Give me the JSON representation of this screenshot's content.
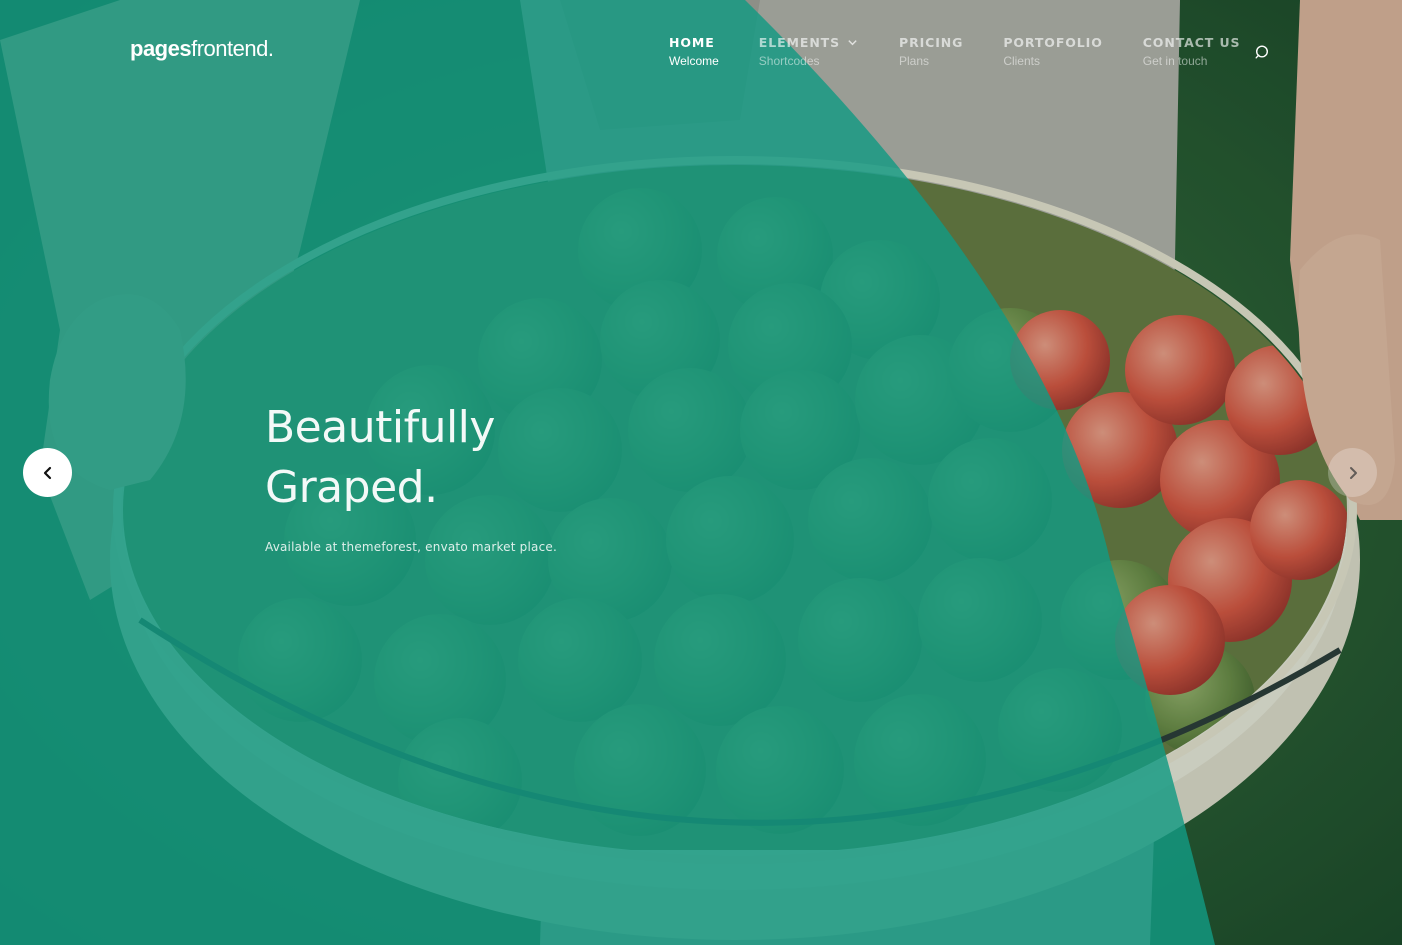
{
  "brand": {
    "name_bold": "pages",
    "name_light": "frontend."
  },
  "nav": [
    {
      "label": "HOME",
      "sub": "Welcome",
      "active": true
    },
    {
      "label": "ELEMENTS",
      "sub": "Shortcodes",
      "dropdown": true
    },
    {
      "label": "PRICING",
      "sub": "Plans"
    },
    {
      "label": "PORTOFOLIO",
      "sub": "Clients"
    },
    {
      "label": "CONTACT US",
      "sub": "Get in touch"
    }
  ],
  "hero": {
    "headline_line1": "Beautifully",
    "headline_line2": "Graped.",
    "subtext": "Available at themeforest, envato market place."
  },
  "icons": {
    "search": "search-icon",
    "prev": "chevron-left-icon",
    "next": "chevron-right-icon",
    "dropdown": "chevron-down-icon"
  },
  "colors": {
    "overlay": "#129a82",
    "accent": "#10cfbd"
  }
}
